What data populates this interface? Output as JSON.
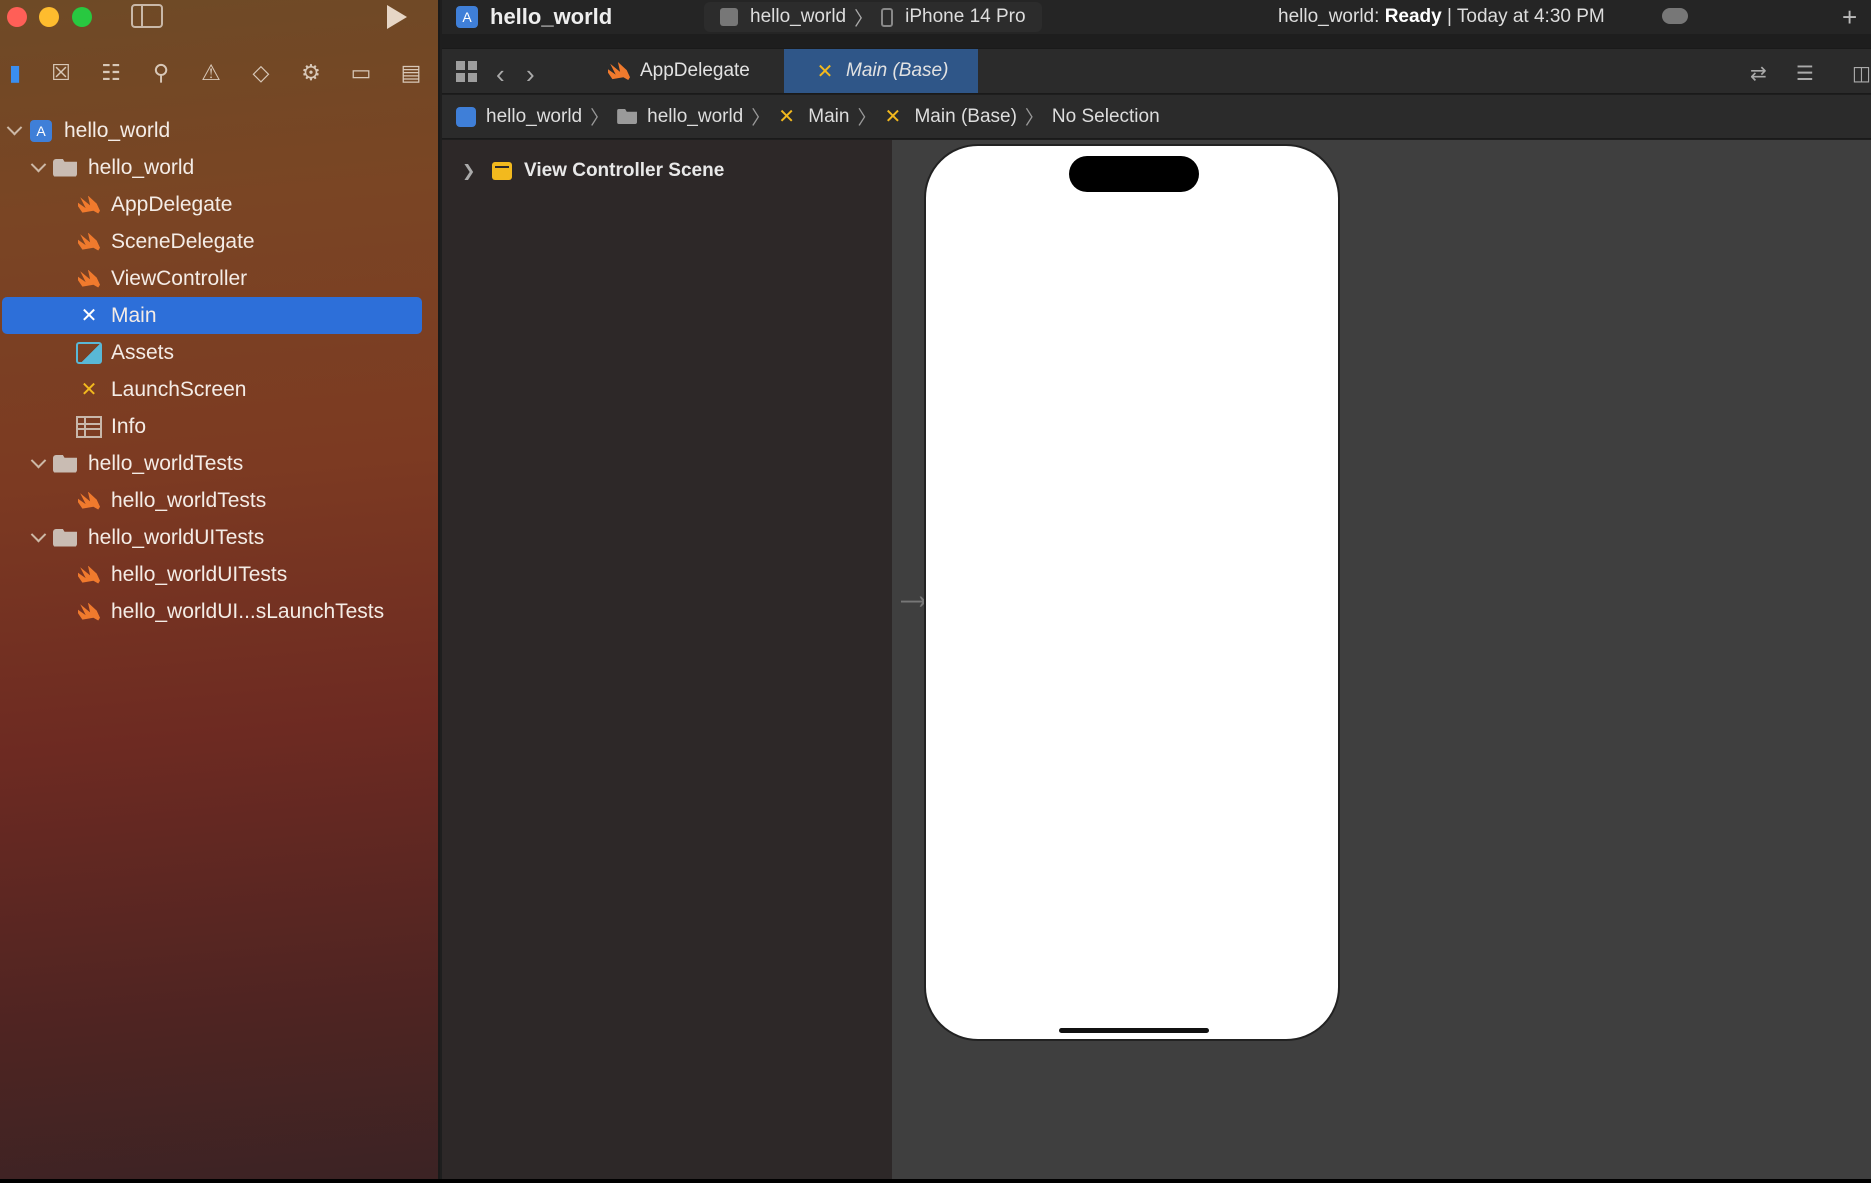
{
  "window": {
    "project_title": "hello_world",
    "scheme": {
      "target": "hello_world",
      "device": "iPhone 14 Pro"
    },
    "status": {
      "prefix": "hello_world:",
      "state": "Ready",
      "time": "| Today at 4:30 PM"
    }
  },
  "navigator": {
    "items": [
      {
        "label": "hello_world"
      },
      {
        "label": "hello_world"
      },
      {
        "label": "AppDelegate"
      },
      {
        "label": "SceneDelegate"
      },
      {
        "label": "ViewController"
      },
      {
        "label": "Main"
      },
      {
        "label": "Assets"
      },
      {
        "label": "LaunchScreen"
      },
      {
        "label": "Info"
      },
      {
        "label": "hello_worldTests"
      },
      {
        "label": "hello_worldTests"
      },
      {
        "label": "hello_worldUITests"
      },
      {
        "label": "hello_worldUITests"
      },
      {
        "label": "hello_worldUI...sLaunchTests"
      }
    ]
  },
  "tabs": [
    {
      "label": "AppDelegate"
    },
    {
      "label": "Main (Base)"
    }
  ],
  "jumpbar": {
    "items": [
      "hello_world",
      "hello_world",
      "Main",
      "Main (Base)",
      "No Selection"
    ]
  },
  "outline": {
    "scene": "View Controller Scene"
  },
  "colors": {
    "selection": "#2d6fd9",
    "active_tab": "#2f5688",
    "swift": "#f07a2d",
    "storyboard": "#f2b91e"
  }
}
